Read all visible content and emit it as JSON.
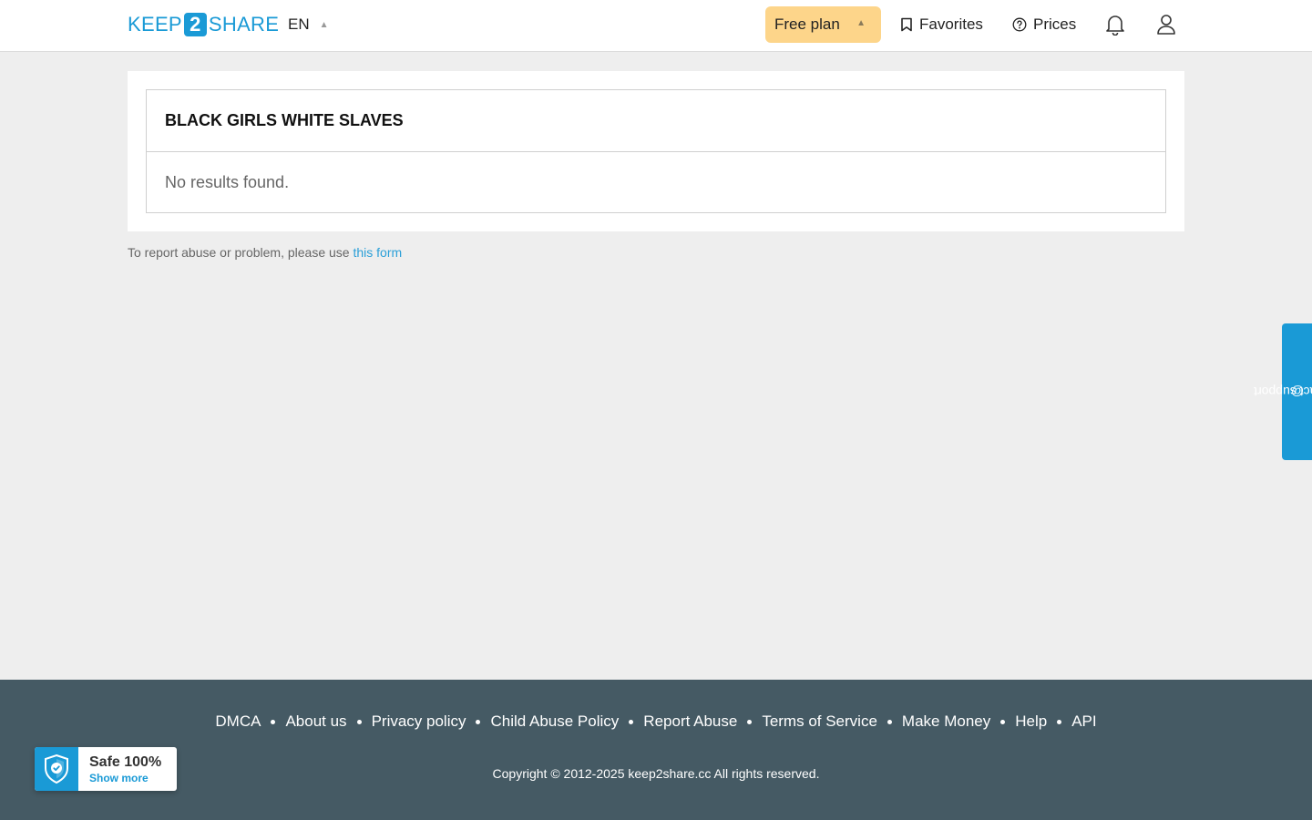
{
  "header": {
    "logo_left": "KEEP",
    "logo_mid": "2",
    "logo_right": "SHARE",
    "language": "EN",
    "plan_label": "Free plan",
    "favorites_label": "Favorites",
    "prices_label": "Prices"
  },
  "main": {
    "title": "BLACK GIRLS WHITE SLAVES",
    "empty_message": "No results found.",
    "report_text": "To report abuse or problem, please use",
    "report_link": "this form"
  },
  "support_tab": {
    "label": "contact support",
    "icon": "at-icon"
  },
  "footer": {
    "links": [
      "DMCA",
      "About us",
      "Privacy policy",
      "Child Abuse Policy",
      "Report Abuse",
      "Terms of Service",
      "Make Money",
      "Help",
      "API"
    ],
    "copyright": "Copyright © 2012-2025 keep2share.cc All rights reserved."
  },
  "safe_badge": {
    "title": "Safe 100%",
    "subtitle": "Show more"
  },
  "colors": {
    "brand": "#1a9ad6",
    "plan_bg": "#fdd58a",
    "footer_bg": "#455a64",
    "page_bg": "#eeeeee"
  }
}
